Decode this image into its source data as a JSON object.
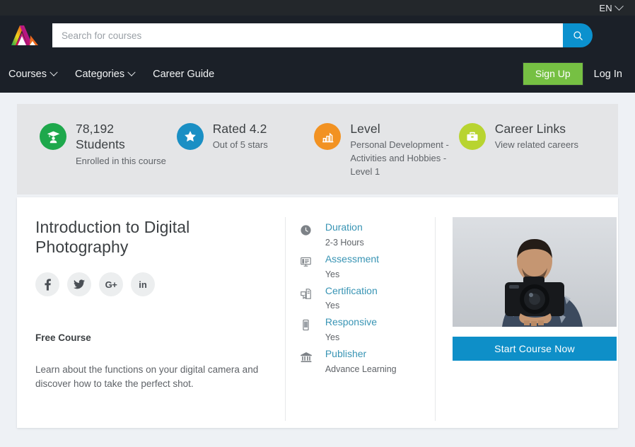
{
  "topbar": {
    "language": "EN",
    "caret_icon": "chevron-down-icon"
  },
  "masthead": {
    "logo_icon": "brand-logo-icon",
    "search": {
      "placeholder": "Search for courses",
      "value": "",
      "button_icon": "search-icon"
    }
  },
  "nav": {
    "links": [
      {
        "label": "Courses",
        "has_caret": true
      },
      {
        "label": "Categories",
        "has_caret": true
      },
      {
        "label": "Career Guide",
        "has_caret": false
      }
    ],
    "sign_up": "Sign Up",
    "log_in": "Log In",
    "signup_color": "#76c043"
  },
  "stats": [
    {
      "icon": "graduation-student-icon",
      "color": "#1ea84c",
      "title_line1": "78,192",
      "title_line2": "Students",
      "sub": "Enrolled in this course"
    },
    {
      "icon": "star-icon",
      "color": "#1a8fc4",
      "title_line1": "Rated 4.2",
      "title_line2": "",
      "sub": "Out of 5 stars"
    },
    {
      "icon": "bar-chart-level-icon",
      "color": "#f29222",
      "title_line1": "Level",
      "title_line2": "",
      "sub": "Personal Development - Activities and Hobbies - Level 1"
    },
    {
      "icon": "briefcase-icon",
      "color": "#b8d430",
      "title_line1": "Career Links",
      "title_line2": "",
      "sub": "View related careers"
    }
  ],
  "course": {
    "title": "Introduction to Digital Photography",
    "social": [
      {
        "name": "facebook",
        "glyph": "f"
      },
      {
        "name": "twitter",
        "glyph": "t"
      },
      {
        "name": "google-plus",
        "glyph": "G+"
      },
      {
        "name": "linkedin",
        "glyph": "in"
      }
    ],
    "price_label": "Free Course",
    "description": "Learn about the functions on your digital camera and discover how to take the perfect shot.",
    "details": [
      {
        "icon": "clock-icon",
        "label": "Duration",
        "value": "2-3 Hours"
      },
      {
        "icon": "assessment-icon",
        "label": "Assessment",
        "value": "Yes"
      },
      {
        "icon": "certificate-icon",
        "label": "Certification",
        "value": "Yes"
      },
      {
        "icon": "mobile-icon",
        "label": "Responsive",
        "value": "Yes"
      },
      {
        "icon": "bank-icon",
        "label": "Publisher",
        "value": "Advance Learning"
      }
    ],
    "hero_image_alt": "man-holding-camera-photo",
    "cta_label": "Start Course Now",
    "cta_color": "#0e8fc8",
    "link_color": "#3894b4"
  }
}
